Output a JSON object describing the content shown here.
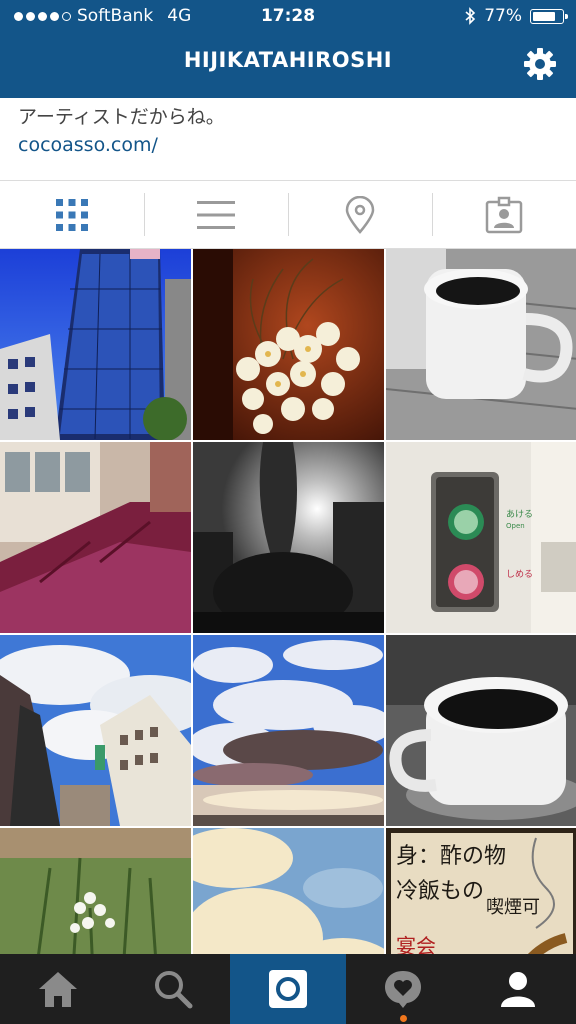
{
  "status_bar": {
    "carrier": "SoftBank",
    "network": "4G",
    "time": "17:28",
    "battery": "77%",
    "battery_level": 0.77
  },
  "header": {
    "username": "HIJIKATAHIROSHI",
    "settings_icon": "gear-icon"
  },
  "bio": {
    "text": "アーティストだからね。",
    "link": "cocoasso.com/"
  },
  "tabs": [
    {
      "name": "grid-view",
      "icon": "grid-icon",
      "active": true
    },
    {
      "name": "list-view",
      "icon": "list-icon",
      "active": false
    },
    {
      "name": "map-view",
      "icon": "map-pin-icon",
      "active": false
    },
    {
      "name": "tagged-view",
      "icon": "tagged-person-icon",
      "active": false
    }
  ],
  "photos": [
    {
      "subject": "glass-building"
    },
    {
      "subject": "orchid-flowers"
    },
    {
      "subject": "coffee-mug"
    },
    {
      "subject": "train-seats"
    },
    {
      "subject": "tree-sun"
    },
    {
      "subject": "elevator-buttons"
    },
    {
      "subject": "city-buildings"
    },
    {
      "subject": "clouds-sky"
    },
    {
      "subject": "coffee-cup"
    },
    {
      "subject": "white-flower"
    },
    {
      "subject": "sky-clouds"
    },
    {
      "subject": "menu-board"
    }
  ],
  "bottom_nav": [
    {
      "name": "home",
      "icon": "home-icon"
    },
    {
      "name": "search",
      "icon": "search-icon"
    },
    {
      "name": "camera",
      "icon": "camera-icon",
      "active": true
    },
    {
      "name": "activity",
      "icon": "heart-bubble-icon"
    },
    {
      "name": "profile",
      "icon": "profile-icon"
    }
  ],
  "colors": {
    "brand": "#135589",
    "tab_active": "#3a78b6",
    "tab_inactive": "#9a9a9a",
    "bottom_bg": "#1f1f1f",
    "notification": "#f0761c"
  }
}
